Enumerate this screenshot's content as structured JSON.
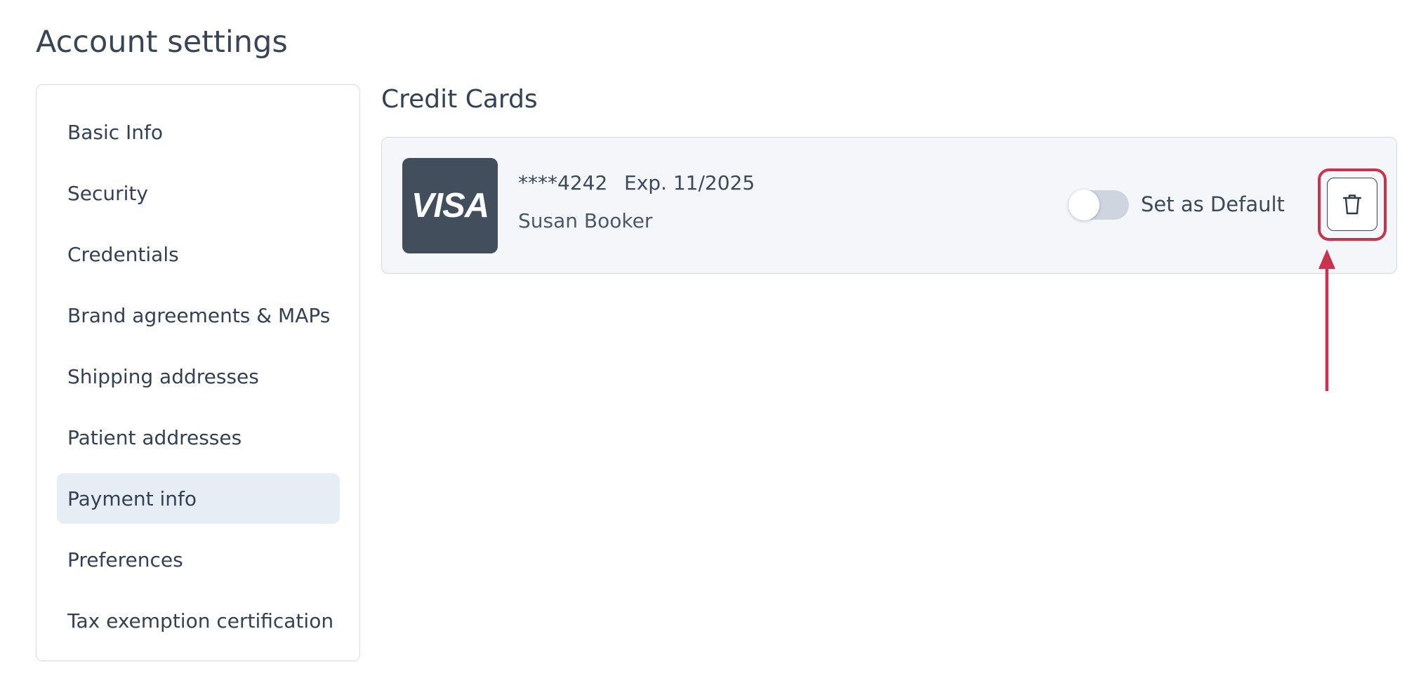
{
  "page": {
    "title": "Account settings"
  },
  "sidebar": {
    "items": [
      {
        "label": "Basic Info",
        "active": false
      },
      {
        "label": "Security",
        "active": false
      },
      {
        "label": "Credentials",
        "active": false
      },
      {
        "label": "Brand agreements & MAPs",
        "active": false
      },
      {
        "label": "Shipping addresses",
        "active": false
      },
      {
        "label": "Patient addresses",
        "active": false
      },
      {
        "label": "Payment info",
        "active": true
      },
      {
        "label": "Preferences",
        "active": false
      },
      {
        "label": "Tax exemption certification",
        "active": false
      }
    ]
  },
  "main": {
    "section_title": "Credit Cards",
    "card": {
      "brand": "VISA",
      "number": "****4242",
      "expiry": "Exp. 11/2025",
      "holder": "Susan Booker",
      "default_toggle_on": false,
      "default_label": "Set as Default",
      "delete_icon": "trash-icon"
    }
  },
  "annotation": {
    "color": "#c8334e",
    "target": "delete-card-button"
  },
  "colors": {
    "text": "#344154",
    "active_bg": "#e7edf5",
    "card_bg": "#f4f6f9",
    "visa_bg": "#434e5c",
    "toggle_off": "#cfd5df"
  }
}
